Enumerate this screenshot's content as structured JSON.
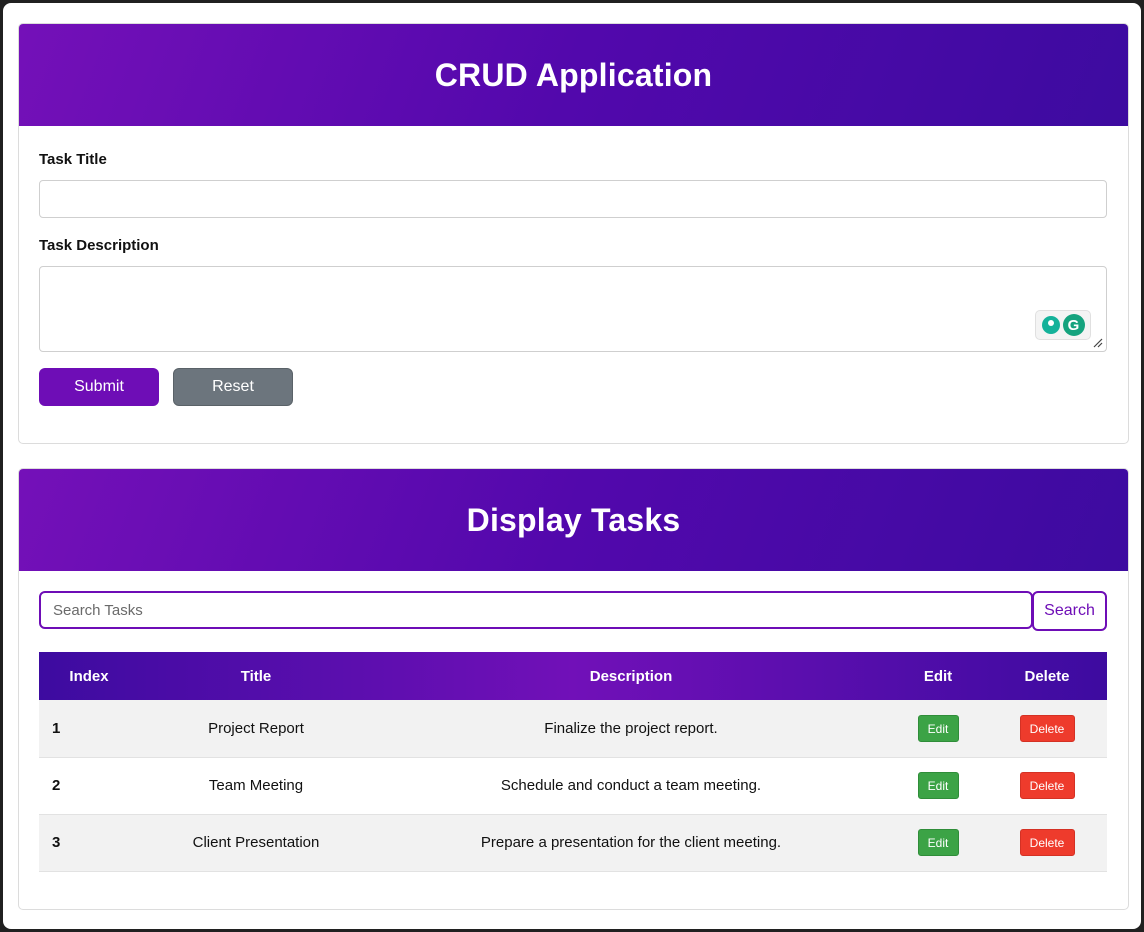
{
  "form": {
    "title": "CRUD Application",
    "task_title_label": "Task Title",
    "task_title_value": "",
    "task_description_label": "Task Description",
    "task_description_value": "",
    "submit_label": "Submit",
    "reset_label": "Reset",
    "grammarly_logo_letter": "G"
  },
  "list": {
    "title": "Display Tasks",
    "search_placeholder": "Search Tasks",
    "search_button_label": "Search",
    "columns": [
      "Index",
      "Title",
      "Description",
      "Edit",
      "Delete"
    ],
    "rows": [
      {
        "index": "1",
        "title": "Project Report",
        "description": "Finalize the project report.",
        "edit": "Edit",
        "delete": "Delete"
      },
      {
        "index": "2",
        "title": "Team Meeting",
        "description": "Schedule and conduct a team meeting.",
        "edit": "Edit",
        "delete": "Delete"
      },
      {
        "index": "3",
        "title": "Client Presentation",
        "description": "Prepare a presentation for the client meeting.",
        "edit": "Edit",
        "delete": "Delete"
      }
    ]
  },
  "colors": {
    "primary": "#6e0db6",
    "header_gradient_start": "#7410b8",
    "header_gradient_end": "#3d0ba0",
    "reset": "#6c757d",
    "edit": "#3ca346",
    "delete": "#ee3b2c"
  },
  "icons": {
    "grammarly_bulb": "lightbulb-icon",
    "grammarly_logo": "grammarly-icon",
    "resize_grip": "resize-grip-icon"
  }
}
